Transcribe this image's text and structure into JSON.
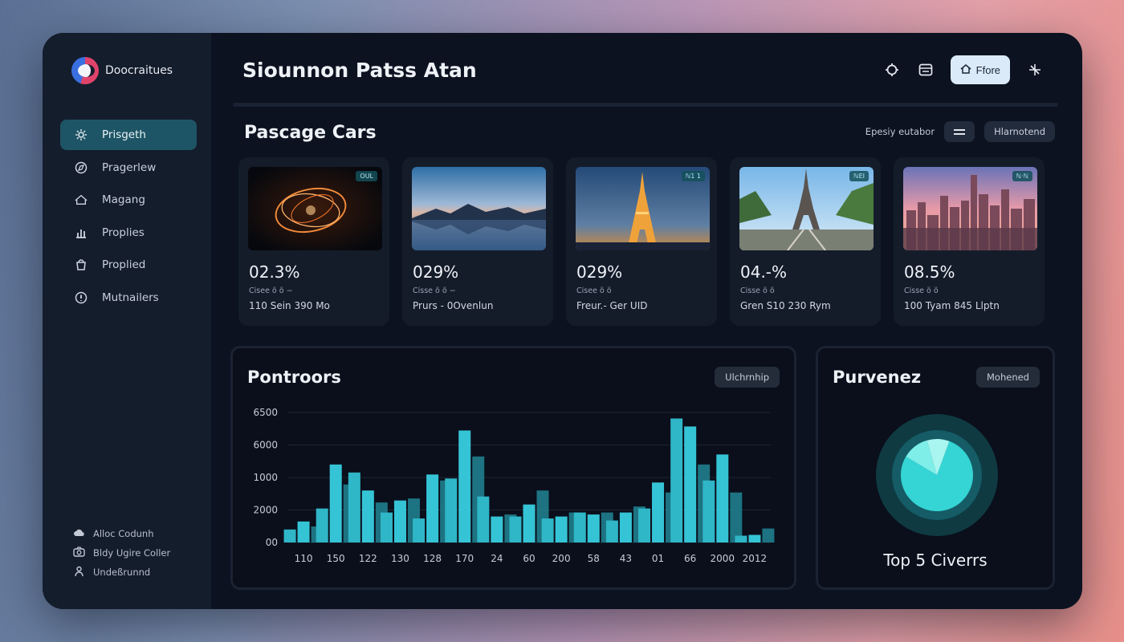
{
  "app": {
    "name": "Doocraitues",
    "title": "Siounnon Patss Atan"
  },
  "sidebar": {
    "items": [
      {
        "label": "Prisgeth",
        "icon": "gear-icon",
        "active": true
      },
      {
        "label": "Pragerlew",
        "icon": "compass-icon",
        "active": false
      },
      {
        "label": "Magang",
        "icon": "home-icon",
        "active": false
      },
      {
        "label": "Proplies",
        "icon": "chart-icon",
        "active": false
      },
      {
        "label": "Proplied",
        "icon": "bag-icon",
        "active": false
      },
      {
        "label": "Mutnailers",
        "icon": "alert-icon",
        "active": false
      }
    ],
    "footer": [
      {
        "label": "Alloc Codunh",
        "icon": "cloud-icon"
      },
      {
        "label": "Bldy Ugire Coller",
        "icon": "camera-icon"
      },
      {
        "label": "Undeßrunnd",
        "icon": "user-icon"
      }
    ]
  },
  "toolbar": {
    "store_label": "Ffore"
  },
  "section": {
    "title": "Pascage Cars",
    "filter_label": "Epesiy eutabor",
    "pill_label": "Hlarnotend"
  },
  "cards": [
    {
      "badge": "OUL",
      "value": "02.3%",
      "sub": "Cisee ö ö −",
      "meta": "110 Sein 390 Mo",
      "image": "swirl"
    },
    {
      "badge": "",
      "value": "029%",
      "sub": "Cisse ö ö −",
      "meta": "Prurs - 0Ovenlun",
      "image": "lake"
    },
    {
      "badge": "ℕ1 1",
      "value": "029%",
      "sub": "Cisee ö ö",
      "meta": "Freur.- Ger UID",
      "image": "eiffel-night"
    },
    {
      "badge": "ℕEI",
      "value": "04.-%",
      "sub": "Cisse ö ö",
      "meta": "Gren S10 230 Rym",
      "image": "eiffel-day"
    },
    {
      "badge": "ℕ·ℕ",
      "value": "08.5%",
      "sub": "Cisse ö ö",
      "meta": "100 Tyam 845 Llptn",
      "image": "city"
    }
  ],
  "chart_panel": {
    "title": "Pontroors",
    "pill_label": "Ulchrnhip"
  },
  "pie_panel": {
    "title": "Purvenez",
    "pill_label": "Mohened",
    "caption": "Top 5 Civerrs"
  },
  "chart_data": {
    "type": "bar",
    "categories": [
      "110",
      "150",
      "122",
      "130",
      "128",
      "170",
      "24",
      "60",
      "200",
      "58",
      "43",
      "01",
      "66",
      "2000",
      "2012"
    ],
    "ytick_labels": [
      "00",
      "2000",
      "1000",
      "6000",
      "6500"
    ],
    "ylim": [
      0,
      6500
    ],
    "grid": true,
    "series": [
      {
        "values": [
          650,
          1700,
          3500,
          1500,
          1200,
          3200,
          2300,
          1300,
          1200,
          1500,
          1100,
          1700,
          6200,
          3100,
          340
        ]
      },
      {
        "values": [
          1050,
          3900,
          2600,
          2100,
          3400,
          5600,
          1300,
          1900,
          1300,
          1400,
          1500,
          3000,
          5800,
          4400,
          380
        ]
      },
      {
        "values": [
          800,
          2900,
          2000,
          2200,
          3100,
          4300,
          1400,
          2600,
          1500,
          1500,
          1800,
          2500,
          3900,
          2500,
          700
        ]
      }
    ],
    "colors": [
      "#2fb6c7",
      "#35c4d6",
      "#1f7e8d"
    ]
  },
  "pie_data": {
    "type": "pie",
    "slices": [
      78,
      12,
      10
    ],
    "colors": [
      "#34d5d4",
      "#7feee9",
      "#a9f5f0"
    ]
  }
}
